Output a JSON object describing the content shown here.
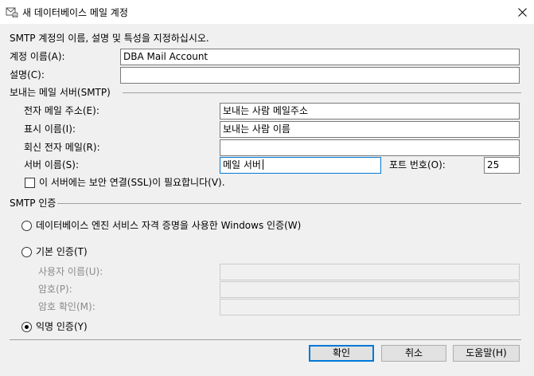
{
  "window": {
    "title": "새 데이터베이스 메일 계정",
    "icon": "database-mail-icon",
    "close_icon": "close-icon"
  },
  "intro": "SMTP 계정의 이름, 설명 및 특성을 지정하십시오.",
  "account_name": {
    "label": "계정 이름(A):",
    "value": "DBA Mail Account"
  },
  "description": {
    "label": "설명(C):",
    "value": ""
  },
  "outgoing_server": {
    "group_label": "보내는 메일 서버(SMTP)",
    "email": {
      "label": "전자 메일 주소(E):",
      "value": "보내는 사람 메일주소"
    },
    "display_name": {
      "label": "표시 이름(I):",
      "value": "보내는 사람 이름"
    },
    "reply_email": {
      "label": "회신 전자 메일(R):",
      "value": ""
    },
    "server_name": {
      "label": "서버 이름(S):",
      "value": "메일 서버"
    },
    "port": {
      "label": "포트 번호(O):",
      "value": "25"
    },
    "ssl": {
      "label": "이 서버에는 보안 연결(SSL)이 필요합니다(V).",
      "checked": false
    }
  },
  "smtp_auth": {
    "group_label": "SMTP 인증",
    "windows_auth": {
      "label": "데이터베이스 엔진 서비스 자격 증명을 사용한 Windows 인증(W)",
      "selected": false
    },
    "basic_auth": {
      "label": "기본 인증(T)",
      "selected": false,
      "username_label": "사용자 이름(U):",
      "password_label": "암호(P):",
      "confirm_label": "암호 확인(M):"
    },
    "anonymous_auth": {
      "label": "익명 인증(Y)",
      "selected": true
    }
  },
  "buttons": {
    "ok": "확인",
    "cancel": "취소",
    "help": "도움말(H)"
  },
  "colors": {
    "focus_border": "#0078d7",
    "dialog_bg": "#f0f0f0"
  }
}
